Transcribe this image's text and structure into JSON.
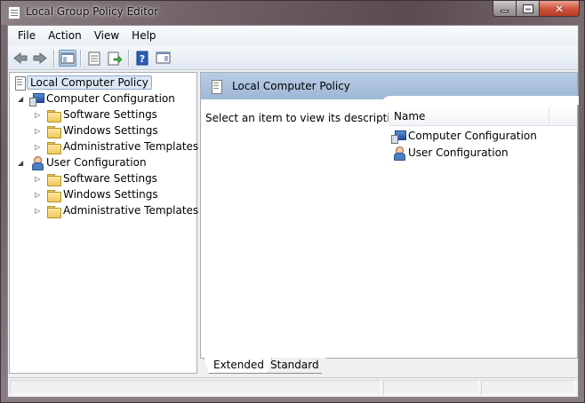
{
  "window": {
    "title": "Local Group Policy Editor"
  },
  "menubar": {
    "items": [
      "File",
      "Action",
      "View",
      "Help"
    ]
  },
  "toolbar": {
    "icons": [
      "back-arrow-icon",
      "forward-arrow-icon",
      "show-hide-console-tree-icon",
      "properties-icon",
      "export-list-icon",
      "help-icon",
      "show-hide-action-pane-icon"
    ]
  },
  "tree": {
    "root": "Local Computer Policy",
    "computer": {
      "label": "Computer Configuration",
      "children": [
        "Software Settings",
        "Windows Settings",
        "Administrative Templates"
      ]
    },
    "user": {
      "label": "User Configuration",
      "children": [
        "Software Settings",
        "Windows Settings",
        "Administrative Templates"
      ]
    }
  },
  "content": {
    "header_title": "Local Computer Policy",
    "description": "Select an item to view its description.",
    "column_name": "Name",
    "items": [
      "Computer Configuration",
      "User Configuration"
    ]
  },
  "tabs": {
    "extended": "Extended",
    "standard": "Standard"
  },
  "colors": {
    "header_blue": "#9db7d6",
    "selection": "#dde8f5"
  }
}
